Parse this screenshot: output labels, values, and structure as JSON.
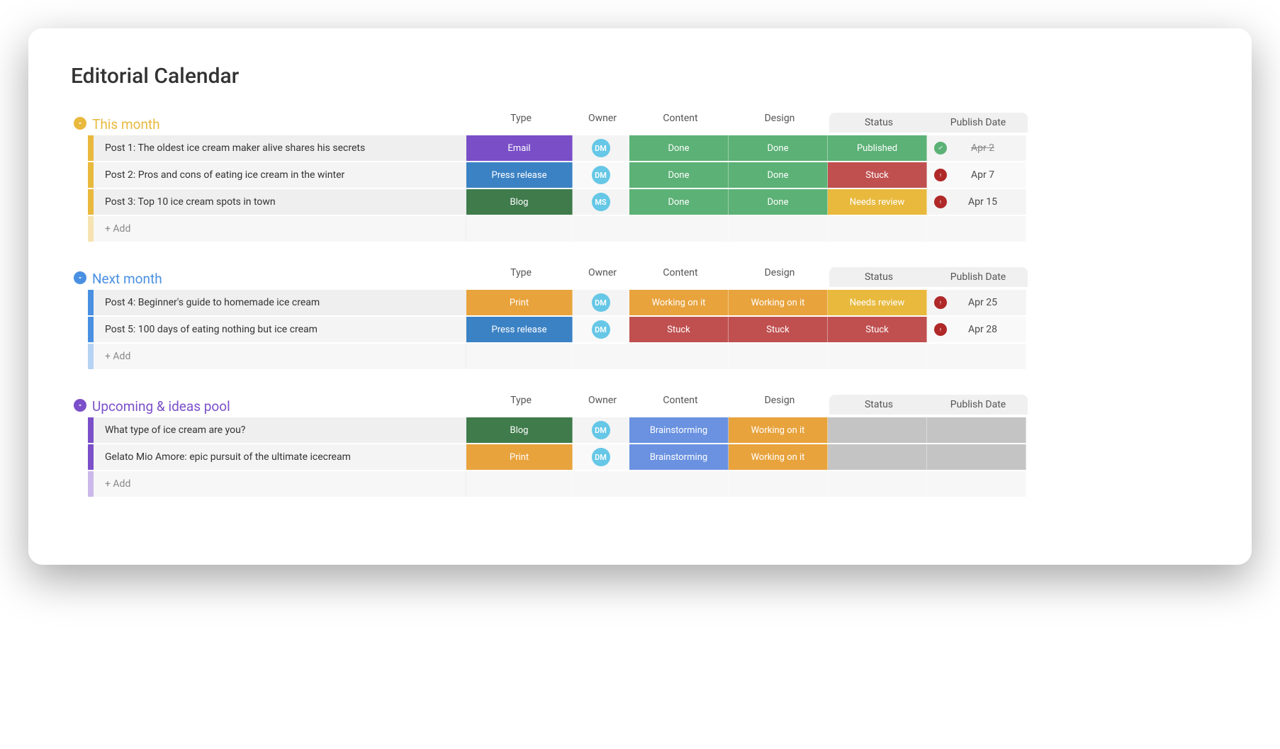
{
  "title": "Editorial Calendar",
  "columns": [
    "Type",
    "Owner",
    "Content",
    "Design",
    "Status",
    "Publish Date"
  ],
  "addLabel": "+ Add",
  "palette": {
    "Email": "#794ec7",
    "Press release": "#3b82c4",
    "Blog": "#3f7b4b",
    "Print": "#e8a33d",
    "Done": "#5cb176",
    "Working on it": "#e8a33d",
    "Stuck": "#c05050",
    "Needs review": "#e8b93d",
    "Published": "#5cb176",
    "Brainstorming": "#6a92e0",
    "empty": "#c4c4c4",
    "ownerAvatar": "#66c7e6",
    "flagOk": "#5cb176",
    "flagWarn": "#b02828"
  },
  "groups": [
    {
      "name": "This month",
      "color": "#e8b93d",
      "rows": [
        {
          "name": "Post 1: The oldest ice cream maker alive shares his secrets",
          "type": "Email",
          "owner": "DM",
          "content": "Done",
          "design": "Done",
          "status": "Published",
          "flag": "ok",
          "date": "Apr 2",
          "dateDone": true
        },
        {
          "name": "Post 2: Pros and cons of eating ice cream in the winter",
          "type": "Press release",
          "owner": "DM",
          "content": "Done",
          "design": "Done",
          "status": "Stuck",
          "flag": "warn",
          "date": "Apr 7",
          "dateDone": false
        },
        {
          "name": "Post 3: Top 10 ice cream spots in town",
          "type": "Blog",
          "owner": "MS",
          "content": "Done",
          "design": "Done",
          "status": "Needs review",
          "flag": "warn",
          "date": "Apr 15",
          "dateDone": false
        }
      ]
    },
    {
      "name": "Next month",
      "color": "#4a90e2",
      "rows": [
        {
          "name": "Post 4: Beginner's guide to homemade ice cream",
          "type": "Print",
          "owner": "DM",
          "content": "Working on it",
          "design": "Working on it",
          "status": "Needs review",
          "flag": "warn",
          "date": "Apr 25",
          "dateDone": false
        },
        {
          "name": "Post 5: 100 days of eating nothing but ice cream",
          "type": "Press release",
          "owner": "DM",
          "content": "Stuck",
          "design": "Stuck",
          "status": "Stuck",
          "flag": "warn",
          "date": "Apr 28",
          "dateDone": false
        }
      ]
    },
    {
      "name": "Upcoming & ideas pool",
      "color": "#7b4fc9",
      "rows": [
        {
          "name": "What type of ice cream are you?",
          "type": "Blog",
          "owner": "DM",
          "content": "Brainstorming",
          "design": "Working on it",
          "status": "",
          "flag": "",
          "date": "",
          "dateDone": false
        },
        {
          "name": "Gelato Mio Amore: epic pursuit of the ultimate icecream",
          "type": "Print",
          "owner": "DM",
          "content": "Brainstorming",
          "design": "Working on it",
          "status": "",
          "flag": "",
          "date": "",
          "dateDone": false
        }
      ]
    }
  ]
}
